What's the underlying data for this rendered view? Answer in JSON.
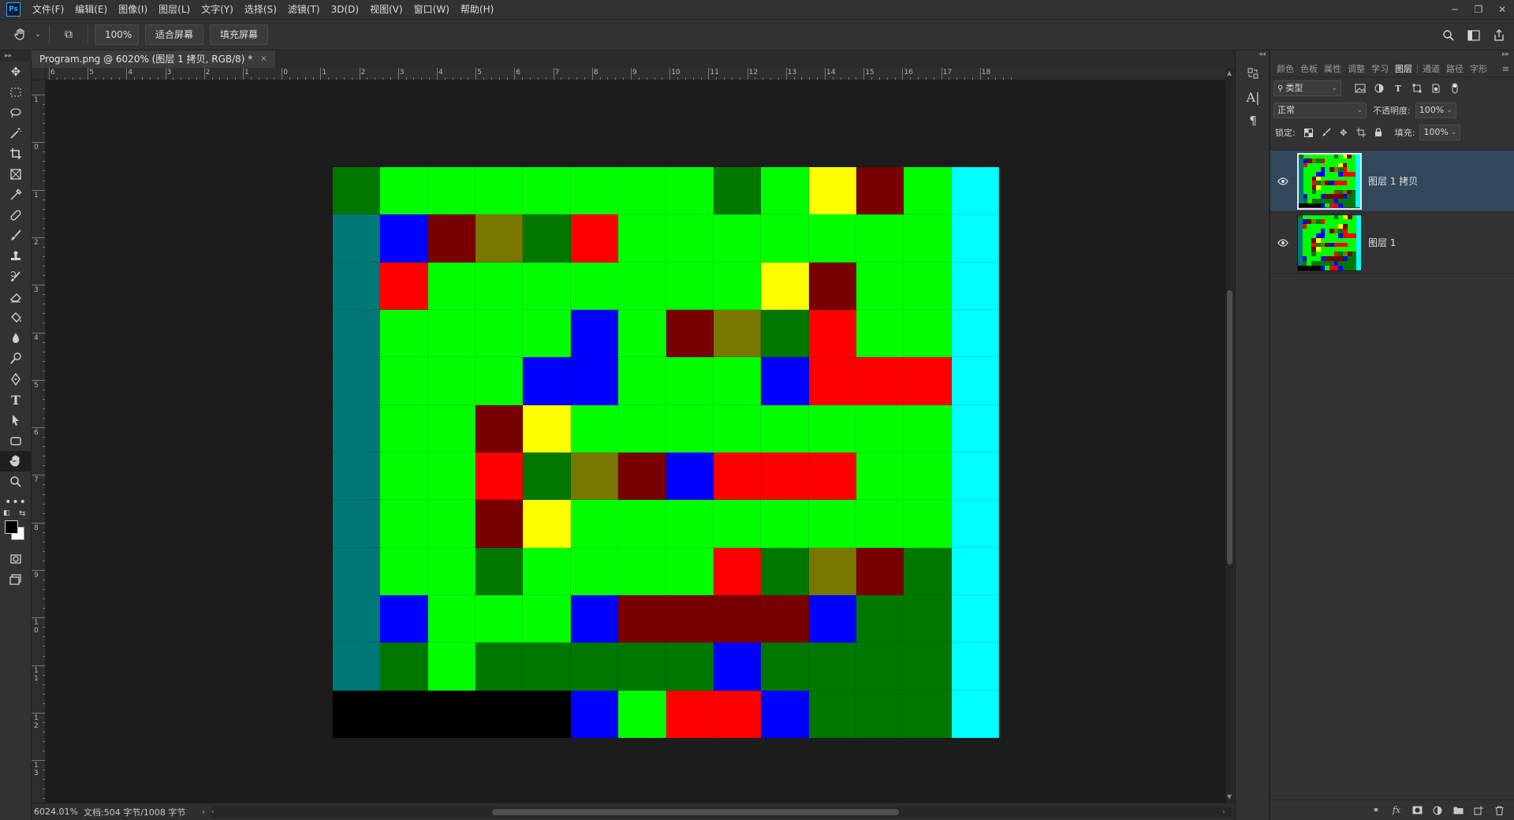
{
  "app": {
    "logo": "Ps",
    "menu": [
      "文件(F)",
      "编辑(E)",
      "图像(I)",
      "图层(L)",
      "文字(Y)",
      "选择(S)",
      "滤镜(T)",
      "3D(D)",
      "视图(V)",
      "窗口(W)",
      "帮助(H)"
    ],
    "window_controls": [
      "minimize-icon",
      "restore-icon",
      "close-icon"
    ]
  },
  "options_bar": {
    "tool_icon": "hand-icon",
    "zoom_value": "100%",
    "fit_screen": "适合屏幕",
    "fill_screen": "填充屏幕",
    "right_icons": [
      "search-icon",
      "workspace-icon",
      "share-icon"
    ]
  },
  "document": {
    "tab_title": "Program.png @ 6020% (图层 1 拷贝, RGB/8) *",
    "close": "×"
  },
  "rulers": {
    "horizontal": [
      "6",
      "5",
      "4",
      "3",
      "2",
      "1",
      "0",
      "1",
      "2",
      "3",
      "4",
      "5",
      "6",
      "7",
      "8",
      "9",
      "10",
      "11",
      "12",
      "13",
      "14",
      "15",
      "16",
      "17",
      "18"
    ],
    "vertical": [
      "1",
      "0",
      "1",
      "2",
      "3",
      "4",
      "5",
      "6",
      "7",
      "8",
      "9",
      "10",
      "11",
      "12",
      "13"
    ]
  },
  "image": {
    "palette": {
      "G": "#00ff00",
      "g": "#007800",
      "B": "#0000ff",
      "R": "#ff0000",
      "r": "#780000",
      "Y": "#ffff00",
      "O": "#787800",
      "T": "#007878",
      "C": "#00ffff",
      "K": "#000000"
    },
    "rows": [
      "gGGGGGGGgGYrGC",
      "TBrOgRGGGGGGGC",
      "TRGGGGGGGYrGGC",
      "TGGGGBGrOgRGGC",
      "TGGGBBGGGBRRRC",
      "TGGrYGGGGGGGGC",
      "TGGRgOrBRRRGGC",
      "TGGrYGGGGGGGGC",
      "TGGgGGGGRgOrgC",
      "TBGGGBrrrrBggC",
      "TgGgggggBggggC",
      "KKKKKBGRRBgggC"
    ]
  },
  "status_bar": {
    "zoom": "6024.01%",
    "doc_size": "文档:504 字节/1008 字节",
    "arrow": "›"
  },
  "panel_strip": {
    "icons": [
      "history-icon",
      "character-icon",
      "paragraph-icon"
    ]
  },
  "layers_panel": {
    "tabs": [
      "颜色",
      "色板",
      "属性",
      "调整",
      "学习",
      "图层",
      "通道",
      "路径",
      "字形"
    ],
    "active_tab": "图层",
    "filter_kind": "类型",
    "blend_mode": "正常",
    "opacity_label": "不透明度:",
    "opacity_value": "100%",
    "lock_label": "锁定:",
    "fill_label": "填充:",
    "fill_value": "100%",
    "layers": [
      {
        "name": "图层 1 拷贝",
        "selected": true,
        "visible": true
      },
      {
        "name": "图层 1",
        "selected": false,
        "visible": true
      }
    ],
    "footer_icons": [
      "link-icon",
      "fx-icon",
      "mask-icon",
      "adjustment-icon",
      "folder-icon",
      "new-layer-icon",
      "trash-icon"
    ]
  }
}
